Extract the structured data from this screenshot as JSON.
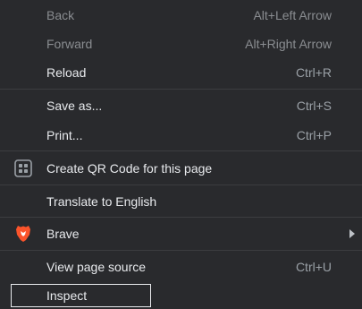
{
  "menu": {
    "items": [
      {
        "label": "Back",
        "shortcut": "Alt+Left Arrow"
      },
      {
        "label": "Forward",
        "shortcut": "Alt+Right Arrow"
      },
      {
        "label": "Reload",
        "shortcut": "Ctrl+R"
      },
      {
        "label": "Save as...",
        "shortcut": "Ctrl+S"
      },
      {
        "label": "Print...",
        "shortcut": "Ctrl+P"
      },
      {
        "label": "Create QR Code for this page"
      },
      {
        "label": "Translate to English"
      },
      {
        "label": "Brave"
      },
      {
        "label": "View page source",
        "shortcut": "Ctrl+U"
      },
      {
        "label": "Inspect"
      }
    ]
  },
  "icons": {
    "qr": "qr-code-icon",
    "brave": "brave-lion-icon",
    "submenu": "chevron-right-icon"
  },
  "colors": {
    "background": "#292a2d",
    "text": "#e8eaed",
    "disabled": "#8a8d91",
    "brave": "#fb542b"
  }
}
